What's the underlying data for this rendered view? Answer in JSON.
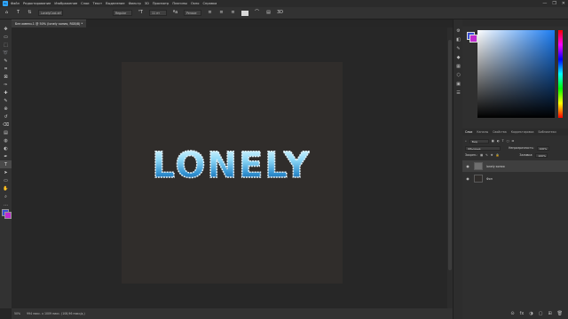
{
  "menu": {
    "logo": "Ps",
    "items": [
      "Файл",
      "Редактирование",
      "Изображение",
      "Слои",
      "Текст",
      "Выделение",
      "Фильтр",
      "3D",
      "Просмотр",
      "Плагины",
      "Окно",
      "Справка"
    ],
    "controls": [
      "—",
      "❐",
      "✕"
    ]
  },
  "options": {
    "font_family": "LonelyCool.otf",
    "font_style": "Regular",
    "font_size": "11 пт",
    "anti_alias": "Резкое"
  },
  "document": {
    "tab_label": "Без имени-1 @ 50% (lonely копия, RGB/8) *",
    "artwork_text": "LONELY"
  },
  "status": {
    "zoom_text": "50%",
    "info_text": "994 пикс. x 1009 пикс. (108,96 пикс/д.)"
  },
  "tools": {
    "icons": [
      "move",
      "artboard",
      "marquee",
      "lasso",
      "quick-select",
      "crop",
      "frame",
      "eyedropper",
      "healing",
      "brush",
      "stamp",
      "history-brush",
      "eraser",
      "gradient",
      "blur",
      "dodge",
      "pen",
      "type",
      "path-select",
      "shape",
      "hand",
      "zoom",
      "more"
    ],
    "glyphs": [
      "✥",
      "▭",
      "⬚",
      "➰",
      "✎",
      "⌗",
      "⊠",
      "✑",
      "✚",
      "✎",
      "⊕",
      "↺",
      "⌫",
      "▤",
      "◍",
      "◐",
      "✒",
      "T",
      "➤",
      "▭",
      "✋",
      "⌕",
      "…"
    ]
  },
  "dock": {
    "glyphs": [
      "⚙",
      "◧",
      "✎",
      "◆",
      "▦",
      "⬡",
      "▣",
      "☰"
    ]
  },
  "layers_panel": {
    "tabs": [
      "Слои",
      "Каналы",
      "Свойства",
      "Корректировка",
      "Библиотеки"
    ],
    "filter_label": "Вид",
    "blend_mode": "Обычные",
    "opacity_label": "Непрозрачность:",
    "opacity_value": "100%",
    "lock_label": "Закреп.:",
    "fill_label": "Заливка:",
    "fill_value": "100%",
    "layers": [
      {
        "name": "lonely копия",
        "selected": true
      },
      {
        "name": "Фон",
        "selected": false
      }
    ],
    "footer_glyphs": [
      "⊝",
      "fx",
      "◑",
      "▢",
      "⊞",
      "🗑"
    ]
  },
  "colors": {
    "foreground": "#3b4fd6",
    "background": "#c02bd0",
    "accent": "#1b7cf2",
    "logo": "#31a8ff"
  }
}
